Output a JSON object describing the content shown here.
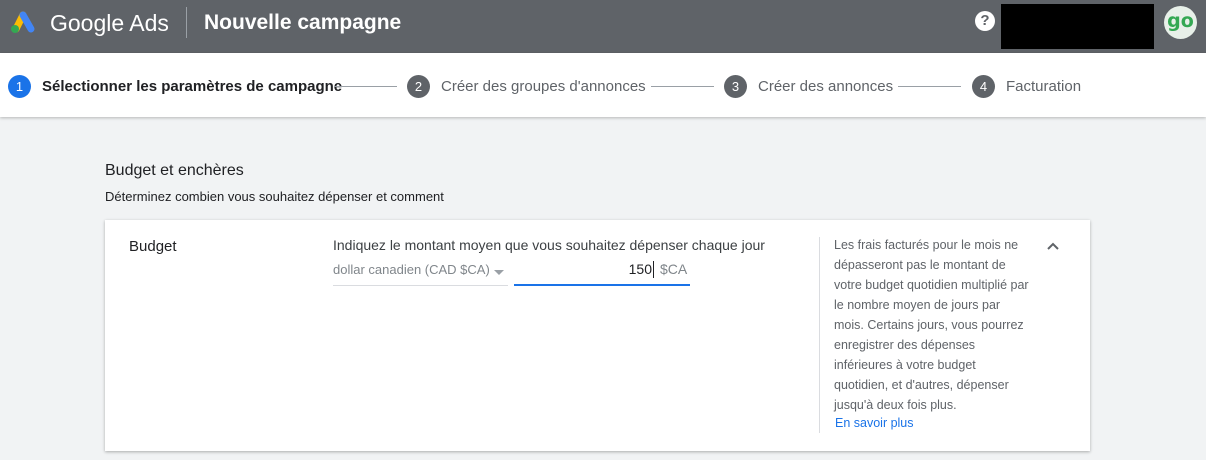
{
  "header": {
    "brand": "Google Ads",
    "title": "Nouvelle campagne",
    "help_icon": "help-icon",
    "help_glyph": "?",
    "avatar_text": "go"
  },
  "stepper": {
    "steps": [
      {
        "number": "1",
        "label": "Sélectionner les paramètres de campagne",
        "active": true
      },
      {
        "number": "2",
        "label": "Créer des groupes d'annonces",
        "active": false
      },
      {
        "number": "3",
        "label": "Créer des annonces",
        "active": false
      },
      {
        "number": "4",
        "label": "Facturation",
        "active": false
      }
    ]
  },
  "section": {
    "title": "Budget et enchères",
    "subtitle": "Déterminez combien vous souhaitez dépenser et comment"
  },
  "budget_card": {
    "label": "Budget",
    "prompt": "Indiquez le montant moyen que vous souhaitez dépenser chaque jour",
    "currency": "dollar canadien (CAD $CA)",
    "amount": "150",
    "amount_suffix": "$CA",
    "help_text": "Les frais facturés pour le mois ne dépasseront pas le montant de votre budget quotidien multiplié par le nombre moyen de jours par mois. Certains jours, vous pourrez enregistrer des dépenses inférieures à votre budget quotidien, et d'autres, dépenser jusqu'à deux fois plus.",
    "learn_more": "En savoir plus"
  },
  "colors": {
    "topbar": "#5f6368",
    "accent": "#1a73e8",
    "avatar_green": "#34a853"
  }
}
